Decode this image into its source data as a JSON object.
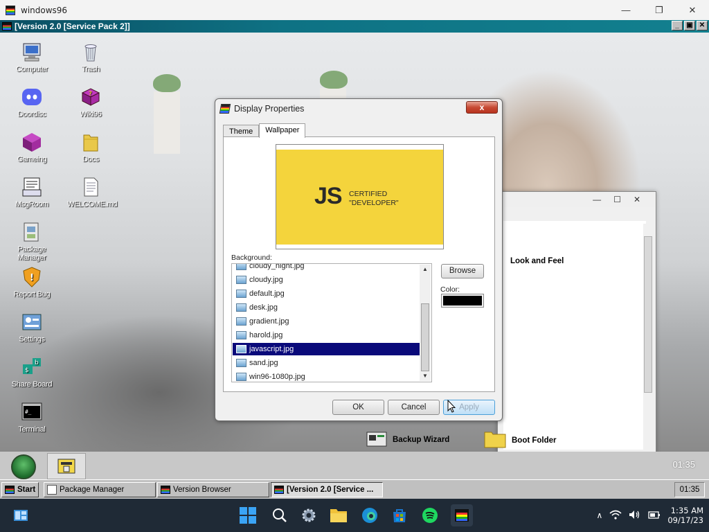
{
  "host_window": {
    "title": "windows96",
    "minimize": "—",
    "restore": "❐",
    "close": "✕"
  },
  "w96_window": {
    "title": "[Version 2.0 [Service Pack 2]]",
    "minimize": "_",
    "maximize": "▣",
    "close": "✕"
  },
  "desktop_icons": [
    {
      "label": "Computer",
      "icon": "computer-icon"
    },
    {
      "label": "Trash",
      "icon": "trash-icon"
    },
    {
      "label": "Doordisc",
      "icon": "discord-icon"
    },
    {
      "label": "Wiki96",
      "icon": "wiki-book-icon"
    },
    {
      "label": "Gameing",
      "icon": "game-cube-icon"
    },
    {
      "label": "Docs",
      "icon": "folder-icon"
    },
    {
      "label": "MsgRoom",
      "icon": "msgroom-icon"
    },
    {
      "label": "WELCOME.md",
      "icon": "document-icon"
    },
    {
      "label": "Package Manager",
      "icon": "package-icon"
    },
    {
      "label": "Report Bug",
      "icon": "shield-icon"
    },
    {
      "label": "Settings",
      "icon": "settings-icon"
    },
    {
      "label": "Share Board",
      "icon": "share-board-icon"
    },
    {
      "label": "Terminal",
      "icon": "terminal-icon"
    }
  ],
  "background_window": {
    "items": [
      {
        "label": "Look and Feel",
        "icon": "look-feel-icon"
      },
      {
        "label": "Backup Wizard",
        "icon": "backup-icon"
      },
      {
        "label": "Boot Folder",
        "icon": "folder-icon"
      }
    ]
  },
  "dialog": {
    "title": "Display Properties",
    "close": "x",
    "tabs": [
      "Theme",
      "Wallpaper"
    ],
    "active_tab": "Wallpaper",
    "preview": {
      "big_text": "JS",
      "line1": "CERTIFIED",
      "line2": "\"DEVELOPER\"",
      "bg_color": "#f4d43c"
    },
    "background_label": "Background:",
    "files": [
      "cloudy_night.jpg",
      "cloudy.jpg",
      "default.jpg",
      "desk.jpg",
      "gradient.jpg",
      "harold.jpg",
      "javascript.jpg",
      "sand.jpg",
      "win96-1080p.jpg"
    ],
    "selected_file": "javascript.jpg",
    "browse_label": "Browse",
    "color_label": "Color:",
    "color_value": "#000000",
    "ok_label": "OK",
    "cancel_label": "Cancel",
    "apply_label": "Apply"
  },
  "quickbar": {
    "clock": "01:35"
  },
  "taskbar96": {
    "start_label": "Start",
    "tasks": [
      "Package Manager",
      "Version Browser",
      "[Version 2.0 [Service ..."
    ],
    "active_task": "[Version 2.0 [Service ...",
    "clock": "01:35"
  },
  "w11_taskbar": {
    "time": "1:35 AM",
    "date": "09/17/23",
    "icons": [
      "widgets-icon",
      "start-icon",
      "search-icon",
      "settings-icon",
      "file-explorer-icon",
      "edge-icon",
      "store-icon",
      "spotify-icon",
      "windows96-icon"
    ]
  },
  "colors": {
    "w96_titlebar": "#0e7284",
    "selection": "#0a0a7a",
    "dialog_close": "#c74a34"
  }
}
